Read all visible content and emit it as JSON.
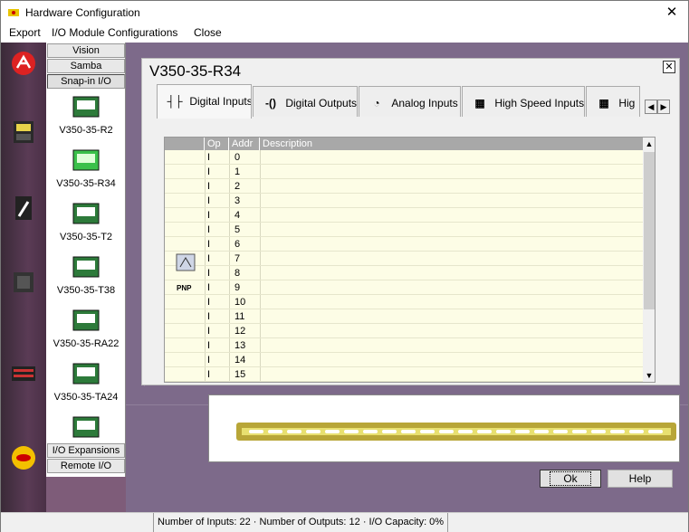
{
  "window": {
    "title": "Hardware Configuration",
    "close_glyph": "✕"
  },
  "menu": {
    "export": "Export",
    "io_module_configurations": "I/O Module Configurations",
    "close": "Close"
  },
  "palette": {
    "tabs": [
      "Vision",
      "Samba",
      "Snap-in I/O"
    ],
    "modules": [
      "V350-35-R2",
      "V350-35-R34",
      "V350-35-T2",
      "V350-35-T38",
      "V350-35-RA22",
      "V350-35-TA24"
    ],
    "bottom_tabs": [
      "I/O Expansions",
      "Remote I/O"
    ]
  },
  "dialog": {
    "title": "V350-35-R34",
    "tabs": [
      "Digital Inputs",
      "Digital Outputs",
      "Analog Inputs",
      "High Speed Inputs",
      "Hig"
    ],
    "grid": {
      "headers": [
        "Op",
        "Addr",
        "Description"
      ],
      "rows": [
        {
          "op": "I",
          "addr": "0"
        },
        {
          "op": "I",
          "addr": "1"
        },
        {
          "op": "I",
          "addr": "2"
        },
        {
          "op": "I",
          "addr": "3"
        },
        {
          "op": "I",
          "addr": "4"
        },
        {
          "op": "I",
          "addr": "5"
        },
        {
          "op": "I",
          "addr": "6"
        },
        {
          "op": "I",
          "addr": "7"
        },
        {
          "op": "I",
          "addr": "8"
        },
        {
          "op": "I",
          "addr": "9"
        },
        {
          "op": "I",
          "addr": "10"
        },
        {
          "op": "I",
          "addr": "11"
        },
        {
          "op": "I",
          "addr": "12"
        },
        {
          "op": "I",
          "addr": "13"
        },
        {
          "op": "I",
          "addr": "14"
        },
        {
          "op": "I",
          "addr": "15"
        }
      ],
      "pnp_label": "PNP"
    }
  },
  "buttons": {
    "ok": "Ok",
    "help": "Help"
  },
  "status": {
    "text": "Number of Inputs: 22  ·  Number of Outputs: 12  ·  I/O Capacity: 0%"
  },
  "colors": {
    "window_bg": "#f0f0f0",
    "grid_body": "#fdfde6",
    "header_gray": "#a8a8a8",
    "workspace": "#7e5c79"
  }
}
